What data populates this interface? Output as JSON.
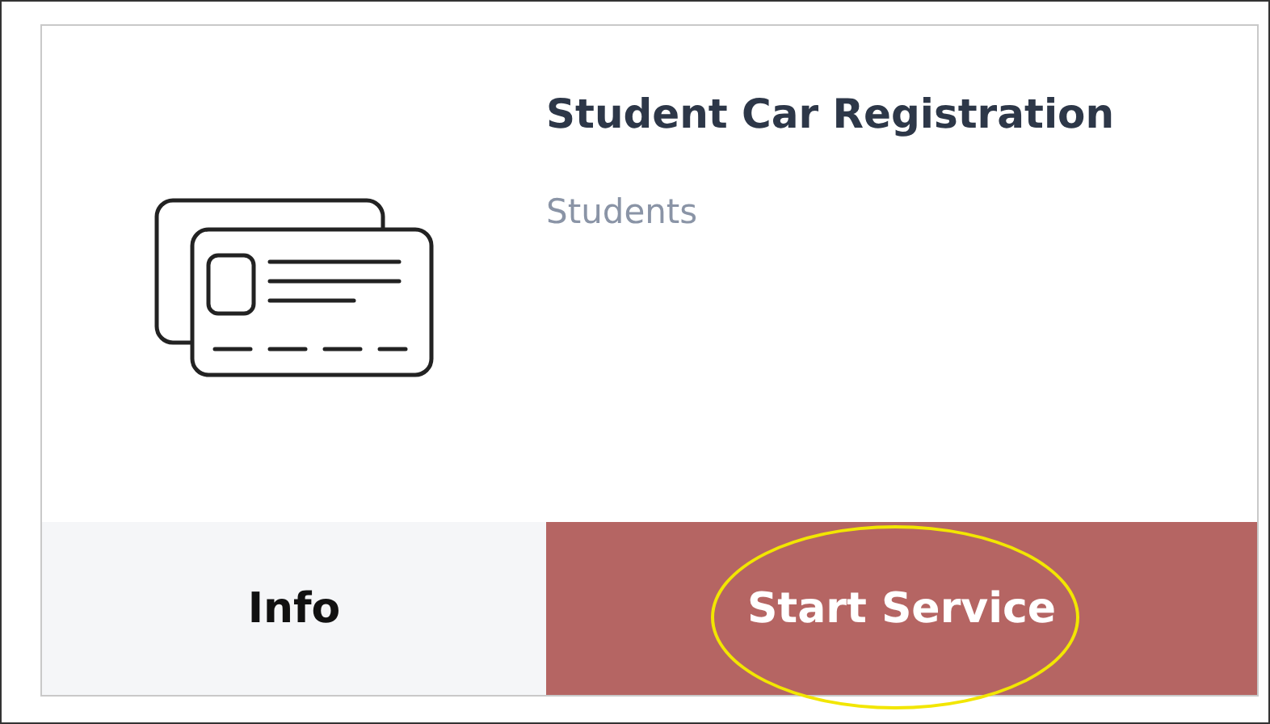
{
  "card": {
    "title": "Student Car Registration",
    "subtitle": "Students"
  },
  "buttons": [
    {
      "label": "Info",
      "kind": "secondary",
      "highlighted": false
    },
    {
      "label": "Start Service",
      "kind": "primary",
      "highlighted": true
    }
  ]
}
